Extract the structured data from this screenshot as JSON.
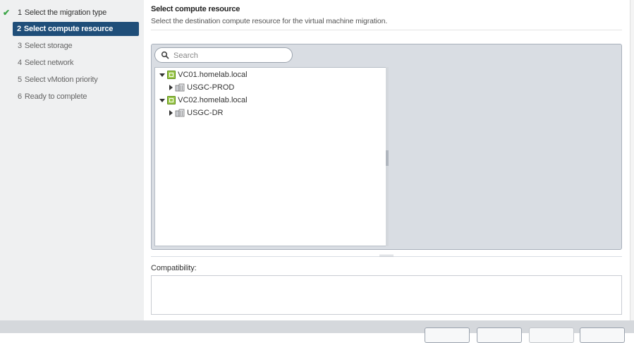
{
  "steps": [
    {
      "num": "1",
      "label": "Select the migration type",
      "state": "done"
    },
    {
      "num": "2",
      "label": "Select compute resource",
      "state": "active"
    },
    {
      "num": "3",
      "label": "Select storage",
      "state": "pending"
    },
    {
      "num": "4",
      "label": "Select network",
      "state": "pending"
    },
    {
      "num": "5",
      "label": "Select vMotion priority",
      "state": "pending"
    },
    {
      "num": "6",
      "label": "Ready to complete",
      "state": "pending"
    }
  ],
  "step_check_icon": "✔",
  "main": {
    "title": "Select compute resource",
    "subtitle": "Select the destination compute resource for the virtual machine migration.",
    "search_placeholder": "Search",
    "compatibility_label": "Compatibility:"
  },
  "tree": [
    {
      "label": "VC01.homelab.local",
      "type": "vcenter",
      "expanded": true,
      "children": [
        {
          "label": "USGC-PROD",
          "type": "datacenter",
          "expanded": false
        }
      ]
    },
    {
      "label": "VC02.homelab.local",
      "type": "vcenter",
      "expanded": true,
      "children": [
        {
          "label": "USGC-DR",
          "type": "datacenter",
          "expanded": false
        }
      ]
    }
  ],
  "colors": {
    "active_step_bg": "#1f4e79",
    "check_green": "#3ba547",
    "vcenter_icon": "#9bc84a",
    "panel_bg": "#d9dde3"
  }
}
